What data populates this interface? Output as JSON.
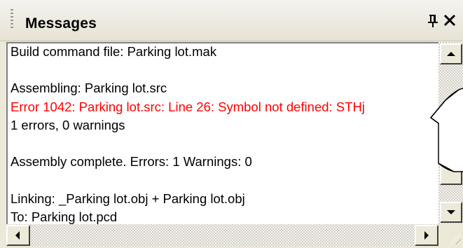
{
  "window": {
    "title": "Messages",
    "pin_glyph": "ᵠ",
    "close_glyph": "✕"
  },
  "messages": [
    {
      "text": "Build command file: Parking lot.mak",
      "type": "normal"
    },
    {
      "text": "",
      "type": "blank"
    },
    {
      "text": "Assembling: Parking lot.src",
      "type": "normal"
    },
    {
      "text": "Error 1042: Parking lot.src: Line 26: Symbol not defined: STHj",
      "type": "error"
    },
    {
      "text": "1 errors, 0 warnings",
      "type": "normal"
    },
    {
      "text": "",
      "type": "blank"
    },
    {
      "text": "Assembly complete.  Errors: 1  Warnings: 0",
      "type": "normal"
    },
    {
      "text": "",
      "type": "blank"
    },
    {
      "text": "Linking: _Parking lot.obj + Parking lot.obj",
      "type": "normal"
    },
    {
      "text": "To: Parking lot.pcd",
      "type": "normal"
    }
  ],
  "colors": {
    "error": "#ff0000",
    "panel": "#ece9d8"
  }
}
